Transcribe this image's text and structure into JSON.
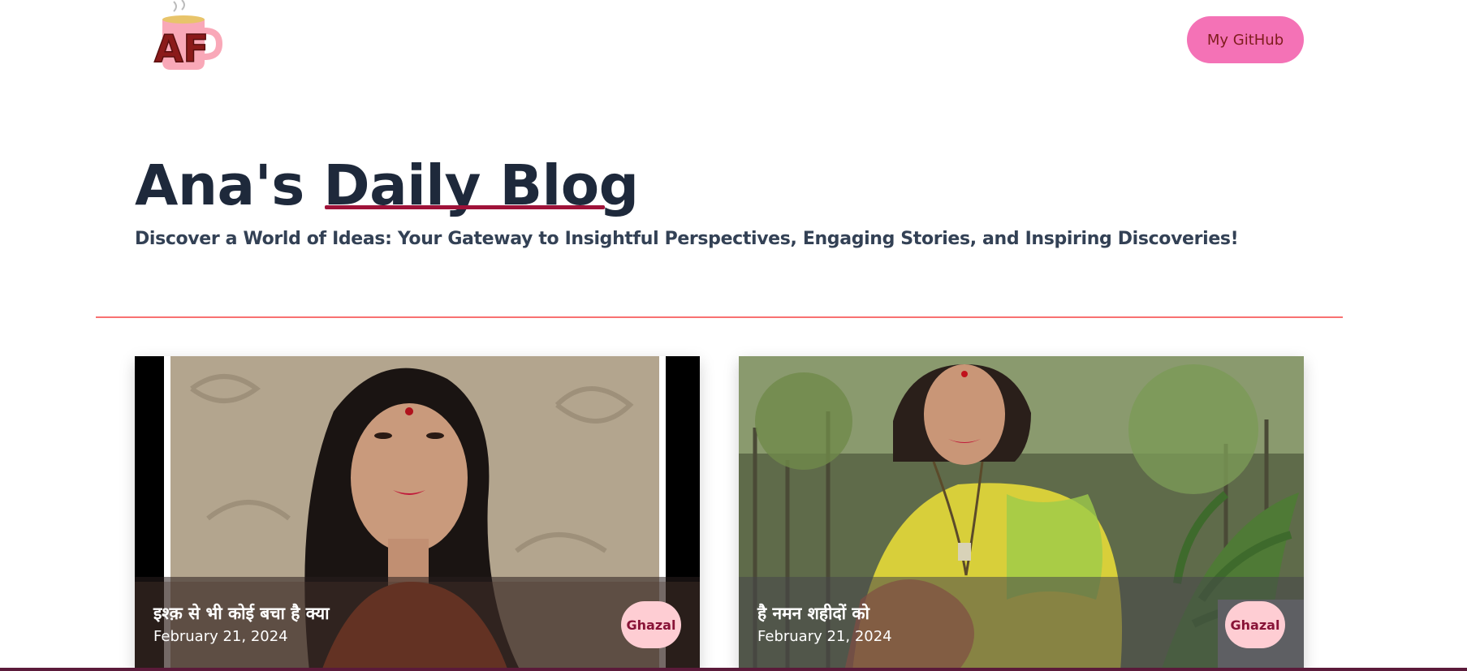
{
  "header": {
    "logo_text": "AF",
    "github_label": "My GitHub"
  },
  "hero": {
    "title_prefix": "Ana's ",
    "title_highlight": "Daily Blog",
    "subtitle": "Discover a World of Ideas: Your Gateway to Insightful Perspectives, Engaging Stories, and Inspiring Discoveries!"
  },
  "posts": [
    {
      "title": "इश्क़ से भी कोई बचा है क्या",
      "date": "February 21, 2024",
      "tag": "Ghazal"
    },
    {
      "title": "है नमन शहीदों को",
      "date": "February 21, 2024",
      "tag": "Ghazal"
    }
  ],
  "colors": {
    "accent": "#f472b6",
    "divider": "#f87171",
    "tag_bg": "#fecdd3",
    "heading": "#1e293b"
  }
}
